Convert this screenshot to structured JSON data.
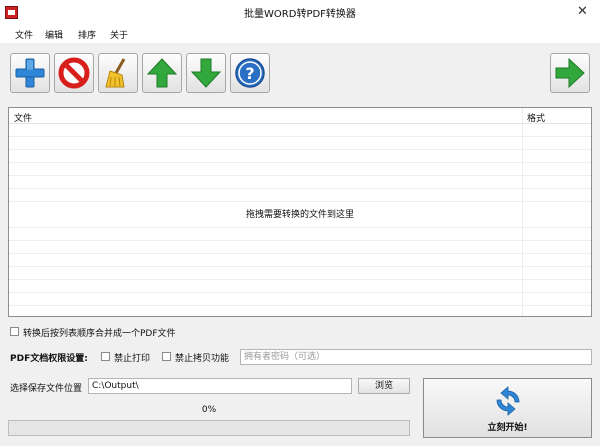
{
  "window": {
    "title": "批量WORD转PDF转换器",
    "close_glyph": "✕"
  },
  "menu": [
    {
      "label": "文件"
    },
    {
      "label": "编辑"
    },
    {
      "label": "排序"
    },
    {
      "label": "关于"
    }
  ],
  "toolbar": {
    "buttons": [
      {
        "icon": "plus-icon"
      },
      {
        "icon": "forbidden-icon"
      },
      {
        "icon": "broom-icon"
      },
      {
        "icon": "arrow-up-icon"
      },
      {
        "icon": "arrow-down-icon"
      },
      {
        "icon": "help-icon"
      },
      {
        "icon": "arrow-right-icon"
      }
    ]
  },
  "list": {
    "col_file": "文件",
    "col_format": "格式",
    "drop_hint": "拖拽需要转换的文件到这里"
  },
  "merge": {
    "label": "转换后按列表顺序合并成一个PDF文件",
    "checked": false
  },
  "permissions": {
    "label": "PDF文档权限设置:",
    "no_print": "禁止打印",
    "no_copy": "禁止拷贝功能",
    "password_placeholder": "拥有者密码（可选）"
  },
  "output": {
    "label": "选择保存文件位置",
    "path": "C:\\Output\\",
    "browse": "浏览"
  },
  "progress": {
    "value": 0,
    "text": "0%"
  },
  "start": {
    "label": "立刻开始!"
  },
  "colors": {
    "accent_blue": "#2f86d6",
    "green": "#32a83c",
    "red": "#d7201b",
    "progress_green": "#06b025"
  }
}
